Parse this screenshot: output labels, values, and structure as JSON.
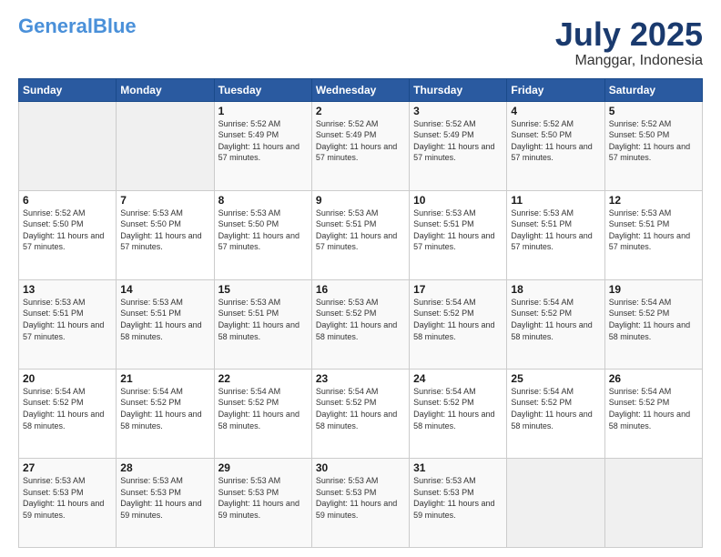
{
  "logo": {
    "general": "General",
    "blue": "Blue"
  },
  "header": {
    "month": "July 2025",
    "location": "Manggar, Indonesia"
  },
  "weekdays": [
    "Sunday",
    "Monday",
    "Tuesday",
    "Wednesday",
    "Thursday",
    "Friday",
    "Saturday"
  ],
  "weeks": [
    [
      {
        "day": "",
        "info": ""
      },
      {
        "day": "",
        "info": ""
      },
      {
        "day": "1",
        "info": "Sunrise: 5:52 AM\nSunset: 5:49 PM\nDaylight: 11 hours and 57 minutes."
      },
      {
        "day": "2",
        "info": "Sunrise: 5:52 AM\nSunset: 5:49 PM\nDaylight: 11 hours and 57 minutes."
      },
      {
        "day": "3",
        "info": "Sunrise: 5:52 AM\nSunset: 5:49 PM\nDaylight: 11 hours and 57 minutes."
      },
      {
        "day": "4",
        "info": "Sunrise: 5:52 AM\nSunset: 5:50 PM\nDaylight: 11 hours and 57 minutes."
      },
      {
        "day": "5",
        "info": "Sunrise: 5:52 AM\nSunset: 5:50 PM\nDaylight: 11 hours and 57 minutes."
      }
    ],
    [
      {
        "day": "6",
        "info": "Sunrise: 5:52 AM\nSunset: 5:50 PM\nDaylight: 11 hours and 57 minutes."
      },
      {
        "day": "7",
        "info": "Sunrise: 5:53 AM\nSunset: 5:50 PM\nDaylight: 11 hours and 57 minutes."
      },
      {
        "day": "8",
        "info": "Sunrise: 5:53 AM\nSunset: 5:50 PM\nDaylight: 11 hours and 57 minutes."
      },
      {
        "day": "9",
        "info": "Sunrise: 5:53 AM\nSunset: 5:51 PM\nDaylight: 11 hours and 57 minutes."
      },
      {
        "day": "10",
        "info": "Sunrise: 5:53 AM\nSunset: 5:51 PM\nDaylight: 11 hours and 57 minutes."
      },
      {
        "day": "11",
        "info": "Sunrise: 5:53 AM\nSunset: 5:51 PM\nDaylight: 11 hours and 57 minutes."
      },
      {
        "day": "12",
        "info": "Sunrise: 5:53 AM\nSunset: 5:51 PM\nDaylight: 11 hours and 57 minutes."
      }
    ],
    [
      {
        "day": "13",
        "info": "Sunrise: 5:53 AM\nSunset: 5:51 PM\nDaylight: 11 hours and 57 minutes."
      },
      {
        "day": "14",
        "info": "Sunrise: 5:53 AM\nSunset: 5:51 PM\nDaylight: 11 hours and 58 minutes."
      },
      {
        "day": "15",
        "info": "Sunrise: 5:53 AM\nSunset: 5:51 PM\nDaylight: 11 hours and 58 minutes."
      },
      {
        "day": "16",
        "info": "Sunrise: 5:53 AM\nSunset: 5:52 PM\nDaylight: 11 hours and 58 minutes."
      },
      {
        "day": "17",
        "info": "Sunrise: 5:54 AM\nSunset: 5:52 PM\nDaylight: 11 hours and 58 minutes."
      },
      {
        "day": "18",
        "info": "Sunrise: 5:54 AM\nSunset: 5:52 PM\nDaylight: 11 hours and 58 minutes."
      },
      {
        "day": "19",
        "info": "Sunrise: 5:54 AM\nSunset: 5:52 PM\nDaylight: 11 hours and 58 minutes."
      }
    ],
    [
      {
        "day": "20",
        "info": "Sunrise: 5:54 AM\nSunset: 5:52 PM\nDaylight: 11 hours and 58 minutes."
      },
      {
        "day": "21",
        "info": "Sunrise: 5:54 AM\nSunset: 5:52 PM\nDaylight: 11 hours and 58 minutes."
      },
      {
        "day": "22",
        "info": "Sunrise: 5:54 AM\nSunset: 5:52 PM\nDaylight: 11 hours and 58 minutes."
      },
      {
        "day": "23",
        "info": "Sunrise: 5:54 AM\nSunset: 5:52 PM\nDaylight: 11 hours and 58 minutes."
      },
      {
        "day": "24",
        "info": "Sunrise: 5:54 AM\nSunset: 5:52 PM\nDaylight: 11 hours and 58 minutes."
      },
      {
        "day": "25",
        "info": "Sunrise: 5:54 AM\nSunset: 5:52 PM\nDaylight: 11 hours and 58 minutes."
      },
      {
        "day": "26",
        "info": "Sunrise: 5:54 AM\nSunset: 5:52 PM\nDaylight: 11 hours and 58 minutes."
      }
    ],
    [
      {
        "day": "27",
        "info": "Sunrise: 5:53 AM\nSunset: 5:53 PM\nDaylight: 11 hours and 59 minutes."
      },
      {
        "day": "28",
        "info": "Sunrise: 5:53 AM\nSunset: 5:53 PM\nDaylight: 11 hours and 59 minutes."
      },
      {
        "day": "29",
        "info": "Sunrise: 5:53 AM\nSunset: 5:53 PM\nDaylight: 11 hours and 59 minutes."
      },
      {
        "day": "30",
        "info": "Sunrise: 5:53 AM\nSunset: 5:53 PM\nDaylight: 11 hours and 59 minutes."
      },
      {
        "day": "31",
        "info": "Sunrise: 5:53 AM\nSunset: 5:53 PM\nDaylight: 11 hours and 59 minutes."
      },
      {
        "day": "",
        "info": ""
      },
      {
        "day": "",
        "info": ""
      }
    ]
  ]
}
